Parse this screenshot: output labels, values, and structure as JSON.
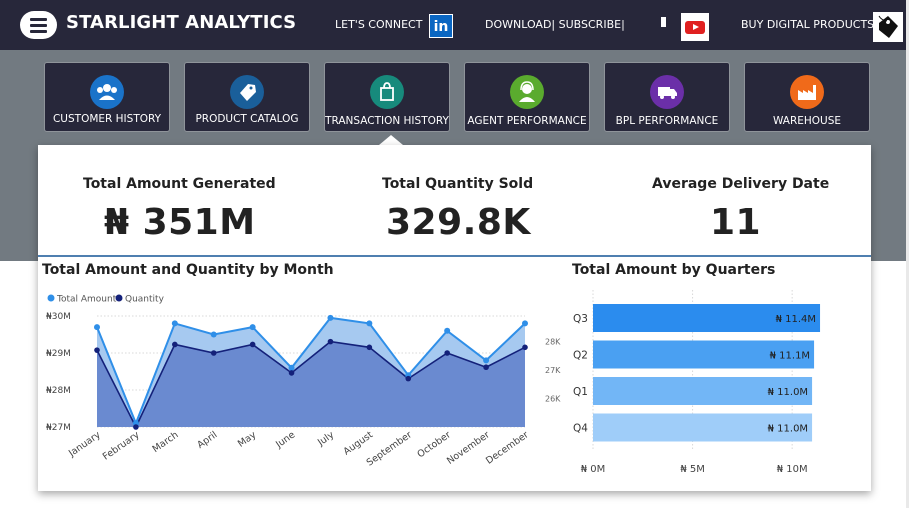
{
  "header": {
    "brand": "STARLIGHT ANALYTICS",
    "connect_label": "LET'S CONNECT",
    "linkedin_glyph": "in",
    "download_label": "DOWNLOAD| SUBSCRIBE|",
    "buy_label": "BUY DIGITAL PRODUCTS",
    "icons": [
      "hamburger-menu-icon",
      "linkedin-icon",
      "youtube-icon",
      "price-tag-icon"
    ]
  },
  "nav": {
    "items": [
      {
        "label": "CUSTOMER HISTORY",
        "icon": "customers-icon",
        "color": "#1a73c9"
      },
      {
        "label": "PRODUCT CATALOG",
        "icon": "tags-icon",
        "color": "#1a5f9a"
      },
      {
        "label": "TRANSACTION HISTORY",
        "icon": "shopping-bag-icon",
        "color": "#178a7c"
      },
      {
        "label": "AGENT PERFORMANCE",
        "icon": "agent-icon",
        "color": "#5aab2e"
      },
      {
        "label": "BPL PERFORMANCE",
        "icon": "delivery-truck-icon",
        "color": "#6b2fa8"
      },
      {
        "label": "WAREHOUSE",
        "icon": "factory-icon",
        "color": "#f06a1a"
      }
    ],
    "active_index": 2
  },
  "kpis": [
    {
      "title": "Total Amount Generated",
      "value": "₦ 351M"
    },
    {
      "title": "Total Quantity Sold",
      "value": "329.8K"
    },
    {
      "title": "Average Delivery Date",
      "value": "11"
    }
  ],
  "colors": {
    "amount_series": "#2f8fe8",
    "quantity_series": "#14217a",
    "area_fill": "#6a8ad0",
    "q3_bar": "#2b8cee",
    "q2_bar": "#4aa0f2",
    "q1_bar": "#72b6f6",
    "q4_bar": "#9fcdf9"
  },
  "chart_data": [
    {
      "type": "area",
      "title": "Total Amount and Quantity by Month",
      "legend": [
        "Total Amount",
        "Quantity"
      ],
      "legend_position": "top-left",
      "categories": [
        "January",
        "February",
        "March",
        "April",
        "May",
        "June",
        "July",
        "August",
        "September",
        "October",
        "November",
        "December"
      ],
      "series": [
        {
          "name": "Total Amount",
          "axis": "left",
          "values": [
            29.7,
            27.1,
            29.8,
            29.5,
            29.7,
            28.6,
            29.95,
            29.8,
            28.4,
            29.6,
            28.8,
            29.8
          ]
        },
        {
          "name": "Quantity",
          "axis": "right",
          "values": [
            27.7,
            25.0,
            27.9,
            27.6,
            27.9,
            26.9,
            28.0,
            27.8,
            26.7,
            27.6,
            27.1,
            27.8
          ]
        }
      ],
      "left_axis": {
        "ticks": [
          27,
          28,
          29,
          30
        ],
        "tick_labels": [
          "₦27M",
          "₦28M",
          "₦29M",
          "₦30M"
        ],
        "ylim": [
          27,
          30
        ]
      },
      "right_axis": {
        "ticks": [
          26,
          27,
          28
        ],
        "tick_labels": [
          "26K",
          "27K",
          "28K"
        ],
        "ylim": [
          25,
          28.9
        ]
      },
      "grid": true
    },
    {
      "type": "bar",
      "orientation": "horizontal",
      "title": "Total Amount by Quarters",
      "categories": [
        "Q3",
        "Q2",
        "Q1",
        "Q4"
      ],
      "values": [
        11.4,
        11.1,
        11.0,
        11.0
      ],
      "data_labels": [
        "₦ 11.4M",
        "₦ 11.1M",
        "₦ 11.0M",
        "₦ 11.0M"
      ],
      "x_ticks": [
        0,
        5,
        10
      ],
      "x_tick_labels": [
        "₦ 0M",
        "₦ 5M",
        "₦ 10M"
      ],
      "xlim": [
        0,
        11.9
      ],
      "grid": true
    }
  ]
}
